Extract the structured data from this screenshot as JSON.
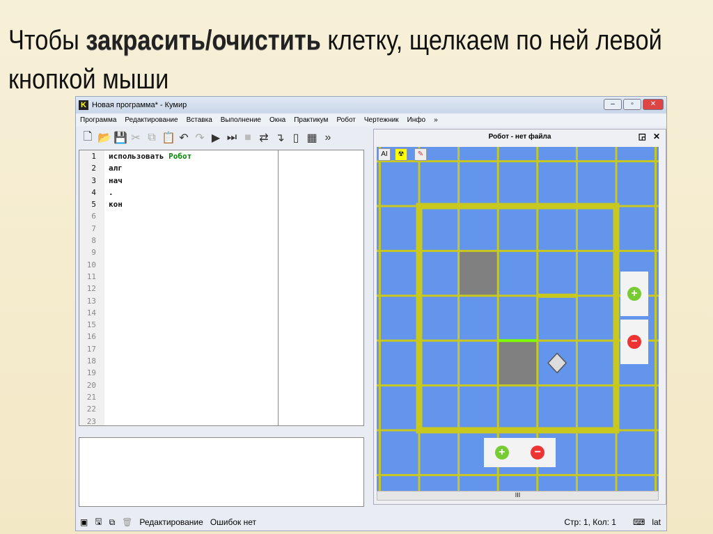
{
  "heading": {
    "line1_pre": "Чтобы ",
    "line1_bold": "закрасить/очистить",
    "line1_post": " клетку, щелкаем по ней левой",
    "line2": "кнопкой мыши"
  },
  "window": {
    "title": "Новая программа* - Кумир",
    "logo": "K"
  },
  "menu": [
    "Программа",
    "Редактирование",
    "Вставка",
    "Выполнение",
    "Окна",
    "Практикум",
    "Робот",
    "Чертежник",
    "Инфо",
    "»"
  ],
  "toolbar_more": "»",
  "editor": {
    "line_numbers": [
      "1",
      "2",
      "3",
      "4",
      "5",
      "6",
      "7",
      "8",
      "9",
      "10",
      "11",
      "12",
      "13",
      "14",
      "15",
      "16",
      "17",
      "18",
      "19",
      "20",
      "21",
      "22",
      "23"
    ],
    "lines": [
      {
        "kw": "использовать ",
        "name": "Робот"
      },
      {
        "kw": "алг"
      },
      {
        "kw": "нач"
      },
      {
        "kw": " ."
      },
      {
        "kw": "кон"
      }
    ]
  },
  "robot": {
    "title": "Робот - нет файла",
    "tools": [
      "AI",
      "☢",
      "✎"
    ],
    "scroll_mark": "III"
  },
  "field": {
    "cols": 5,
    "rows": 5,
    "painted": [
      [
        1,
        1
      ],
      [
        2,
        3
      ]
    ],
    "robot": [
      3,
      3
    ]
  },
  "status": {
    "mode": "Редактирование",
    "errors": "Ошибок нет",
    "position": "Стр: 1, Кол: 1",
    "layout": "lat"
  },
  "colors": {
    "field": "#6495ed",
    "grid": "#c8c81e",
    "painted": "#808080",
    "wall_green": "#7fff00"
  }
}
